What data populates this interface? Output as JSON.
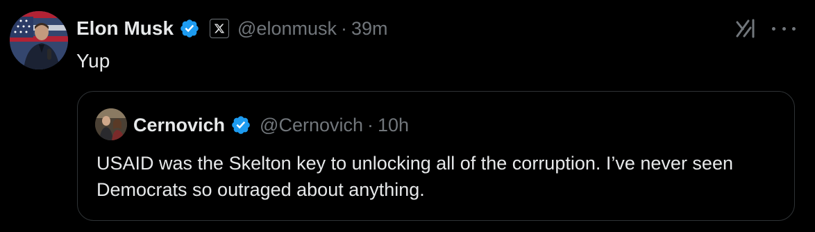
{
  "post": {
    "author_name": "Elon Musk",
    "author_handle": "@elonmusk",
    "separator": "·",
    "time": "39m",
    "text": "Yup",
    "affiliate_icon": "x-logo-icon",
    "verified_icon": "verified-badge-icon",
    "actions": {
      "grok_icon": "grok-icon",
      "more_icon": "more-options-icon"
    }
  },
  "quote": {
    "author_name": "Cernovich",
    "author_handle": "@Cernovich",
    "separator": "·",
    "time": "10h",
    "text": "USAID was the Skelton key to unlocking all of the corruption. I’ve never seen Democrats so outraged about anything.",
    "verified_icon": "verified-badge-icon"
  },
  "colors": {
    "background": "#000000",
    "primary_text": "#e7e9ea",
    "secondary_text": "#71767b",
    "verified_blue": "#1d9bf0",
    "border": "#2f3336"
  }
}
